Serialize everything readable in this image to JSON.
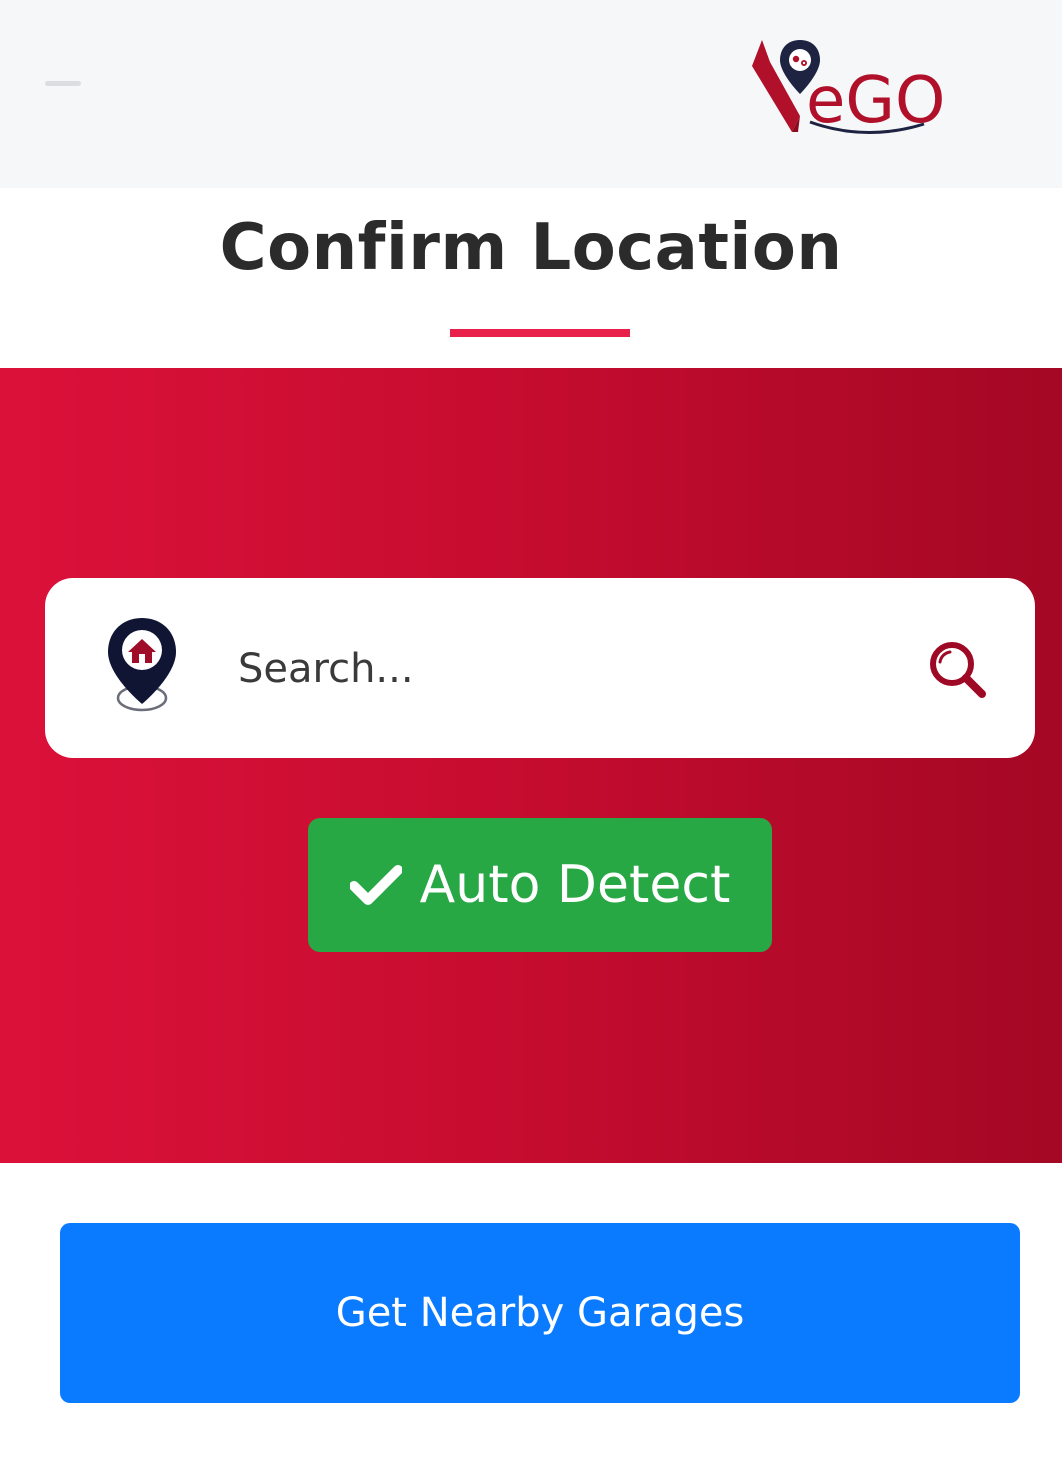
{
  "header": {
    "menu_icon": "hamburger-icon",
    "logo": {
      "text": "eGO",
      "icon": "garage-pin-logo",
      "colors": {
        "primary": "#b0102a",
        "navy": "#1d2341"
      }
    }
  },
  "page": {
    "title": "Confirm Location",
    "accent_color": "#e8204a"
  },
  "search": {
    "leading_icon": "home-location-pin-icon",
    "placeholder": "Search...",
    "value": "",
    "trailing_icon": "search-icon"
  },
  "auto_detect": {
    "icon": "check-icon",
    "label": "Auto Detect",
    "color": "#28a745"
  },
  "cta": {
    "label": "Get Nearby Garages",
    "color": "#0a7bff"
  },
  "hero": {
    "gradient": [
      "#dc113a",
      "#c50c2f",
      "#a40824"
    ]
  }
}
